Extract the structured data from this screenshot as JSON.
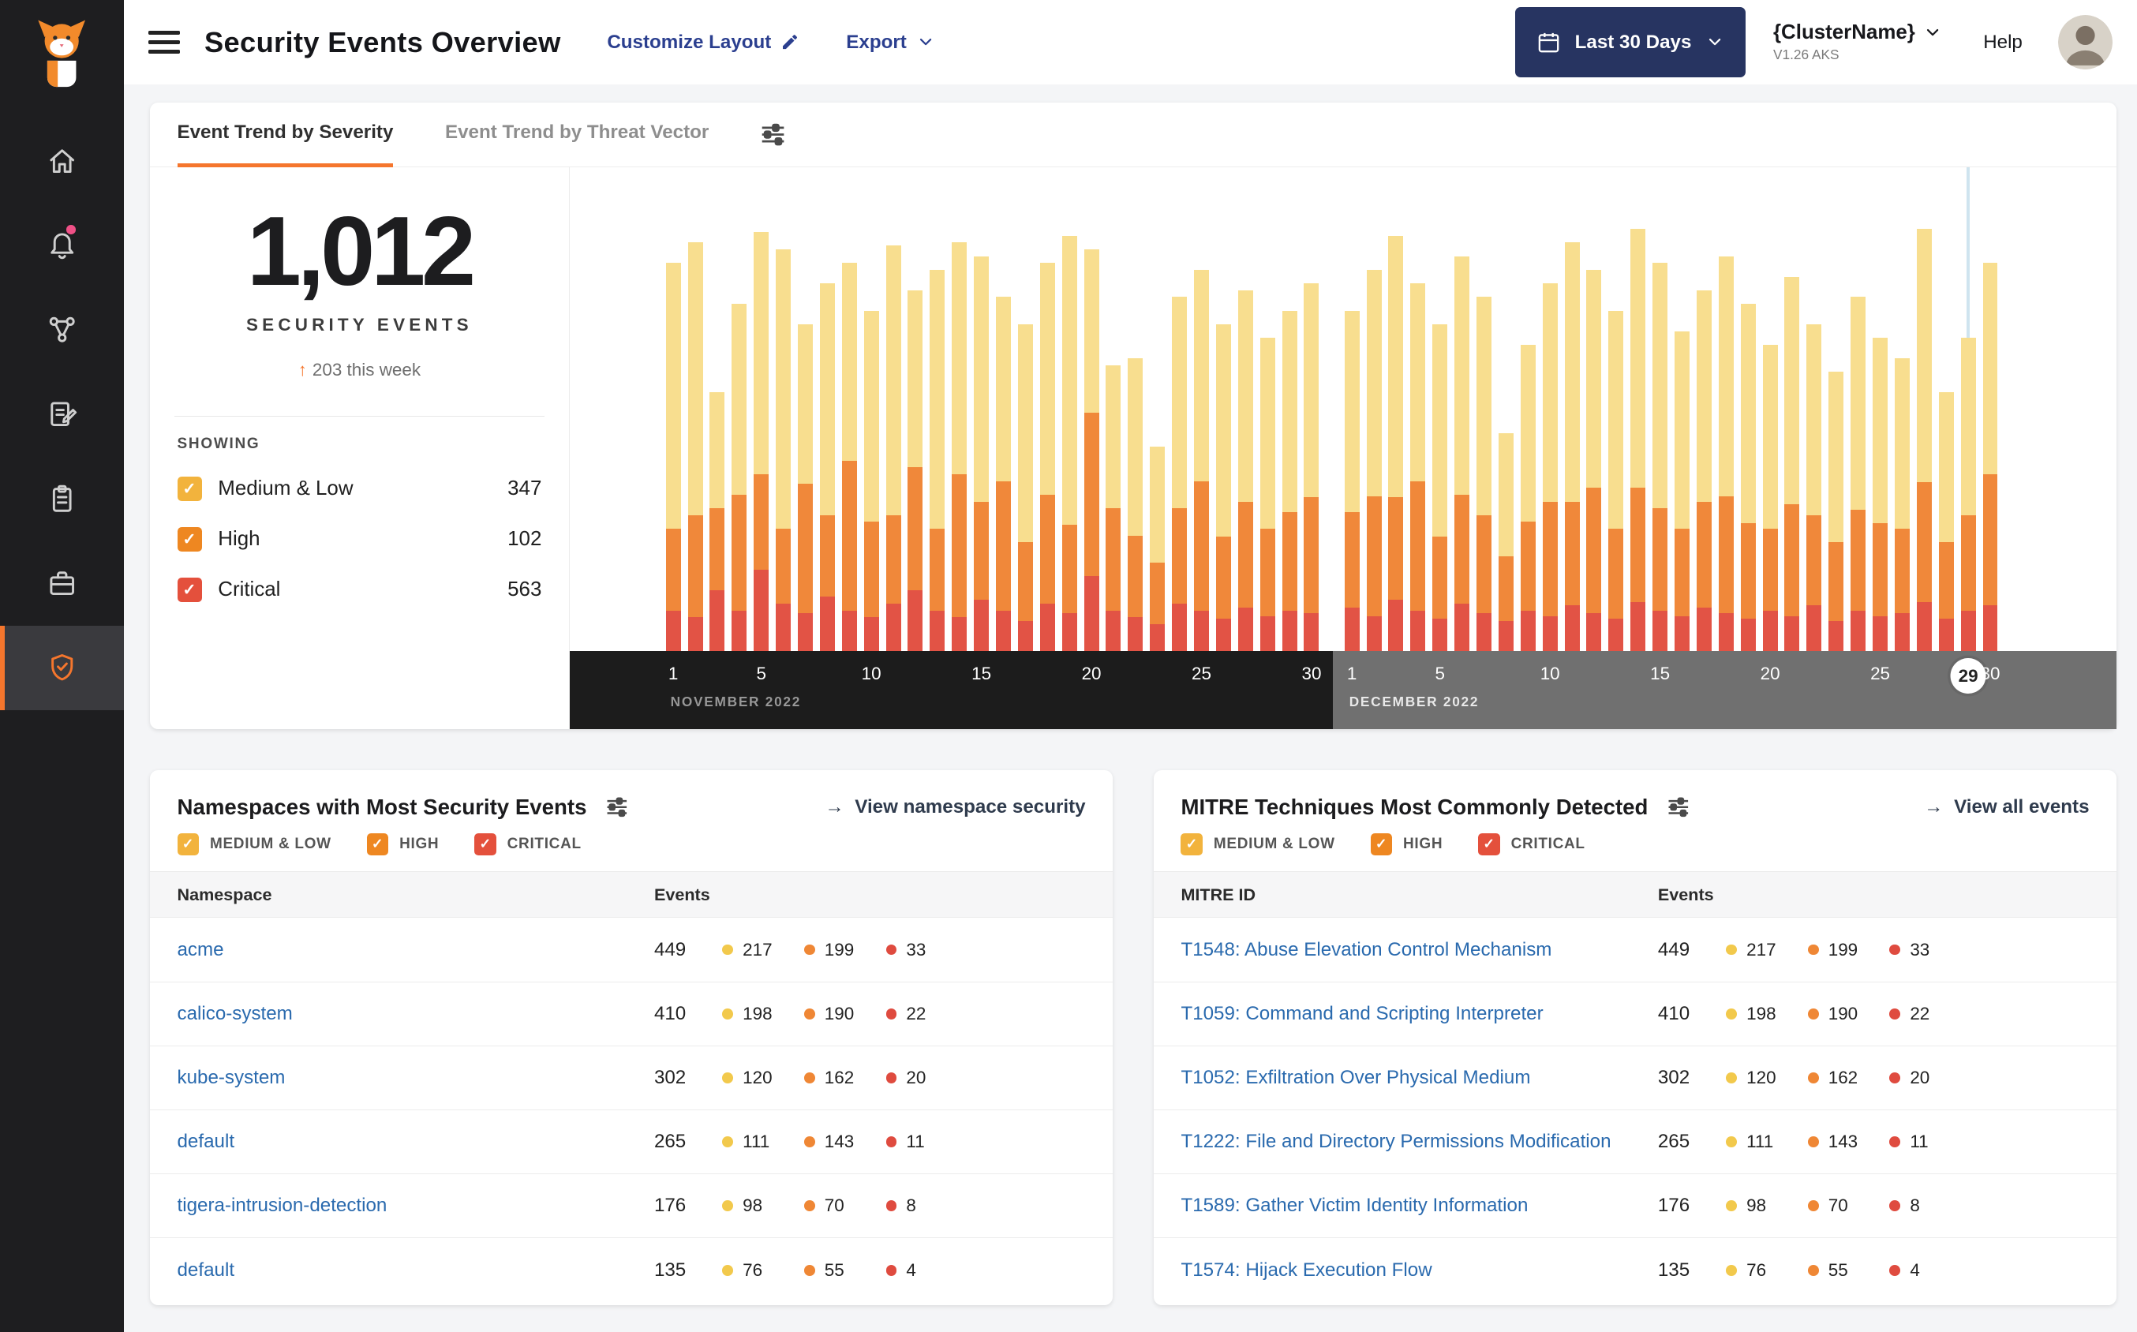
{
  "colors": {
    "medium_low": "#F2B33D",
    "high": "#EE8721",
    "critical": "#E4503C",
    "bar_medium_low": "#F8DE8F",
    "bar_high": "#F0883A",
    "bar_critical": "#E25345",
    "dot_medium_low": "#F2C94C",
    "dot_high": "#EF8735",
    "dot_critical": "#DF4B3F",
    "accent_orange": "#F5762D",
    "link_blue": "#2A6AAE",
    "nav_navy": "#2B3F8F",
    "button_navy": "#273461"
  },
  "sidebar": {
    "items": [
      {
        "icon": "home-icon",
        "active": false
      },
      {
        "icon": "alerts-bell-icon",
        "active": false,
        "notification_dot": true
      },
      {
        "icon": "service-graph-icon",
        "active": false
      },
      {
        "icon": "policies-edit-icon",
        "active": false
      },
      {
        "icon": "compliance-clipboard-icon",
        "active": false
      },
      {
        "icon": "workloads-box-icon",
        "active": false
      },
      {
        "icon": "threat-defense-shield-icon",
        "active": true
      }
    ]
  },
  "header": {
    "title": "Security Events Overview",
    "customize_label": "Customize Layout",
    "export_label": "Export",
    "date_range_label": "Last 30 Days",
    "cluster_name": "{ClusterName}",
    "cluster_version": "V1.26 AKS",
    "help_label": "Help"
  },
  "trend": {
    "tabs": [
      {
        "label": "Event Trend by Severity",
        "active": true
      },
      {
        "label": "Event Trend by Threat Vector",
        "active": false
      }
    ],
    "total": "1,012",
    "total_caption": "SECURITY EVENTS",
    "delta_arrow": "↑",
    "delta_text": "203 this week",
    "showing_label": "SHOWING",
    "legend": [
      {
        "label": "Medium & Low",
        "count": "347",
        "sev": "medium_low"
      },
      {
        "label": "High",
        "count": "102",
        "sev": "high"
      },
      {
        "label": "Critical",
        "count": "563",
        "sev": "critical"
      }
    ]
  },
  "chart_data": {
    "type": "bar",
    "stacked": true,
    "title": "Event Trend by Severity",
    "series_meta": [
      {
        "name": "Medium & Low",
        "color": "#F8DE8F"
      },
      {
        "name": "High",
        "color": "#F0883A"
      },
      {
        "name": "Critical",
        "color": "#E25345"
      }
    ],
    "selected": {
      "month_index": 1,
      "day": 29
    },
    "months": [
      {
        "label": "NOVEMBER 2022",
        "tick_days": [
          1,
          5,
          10,
          15,
          20,
          25,
          30
        ],
        "critical": [
          30,
          25,
          45,
          30,
          60,
          35,
          28,
          40,
          30,
          25,
          35,
          45,
          30,
          25,
          38,
          30,
          22,
          35,
          28,
          55,
          30,
          25,
          20,
          35,
          30,
          24,
          32,
          26,
          30,
          28
        ],
        "high": [
          60,
          75,
          60,
          85,
          70,
          55,
          95,
          60,
          110,
          70,
          65,
          90,
          60,
          105,
          72,
          95,
          58,
          80,
          65,
          120,
          75,
          60,
          45,
          70,
          95,
          60,
          78,
          64,
          72,
          85
        ],
        "medium_low": [
          195,
          200,
          85,
          140,
          178,
          205,
          117,
          170,
          145,
          155,
          198,
          130,
          190,
          170,
          180,
          135,
          160,
          170,
          212,
          120,
          105,
          130,
          85,
          155,
          155,
          156,
          155,
          140,
          148,
          157
        ]
      },
      {
        "label": "DECEMBER 2022",
        "tick_days": [
          1,
          5,
          10,
          15,
          20,
          25,
          30
        ],
        "critical": [
          32,
          26,
          38,
          30,
          24,
          35,
          28,
          22,
          30,
          26,
          34,
          28,
          24,
          36,
          30,
          26,
          32,
          28,
          24,
          30,
          26,
          34,
          22,
          30,
          26,
          28,
          36,
          24,
          30,
          34
        ],
        "high": [
          70,
          88,
          75,
          95,
          60,
          80,
          72,
          48,
          65,
          84,
          76,
          92,
          66,
          84,
          75,
          64,
          78,
          86,
          70,
          60,
          82,
          66,
          58,
          74,
          68,
          62,
          88,
          56,
          70,
          96
        ],
        "medium_low": [
          148,
          166,
          192,
          145,
          156,
          175,
          160,
          90,
          130,
          160,
          190,
          160,
          160,
          190,
          180,
          145,
          155,
          176,
          161,
          135,
          167,
          140,
          125,
          156,
          136,
          125,
          186,
          110,
          130,
          155
        ]
      }
    ]
  },
  "namespaces_card": {
    "title": "Namespaces with Most Security Events",
    "action_arrow": "→",
    "action_label": "View namespace security",
    "filters": [
      {
        "label": "MEDIUM & LOW",
        "sev": "medium_low"
      },
      {
        "label": "HIGH",
        "sev": "high"
      },
      {
        "label": "CRITICAL",
        "sev": "critical"
      }
    ],
    "columns": [
      "Namespace",
      "Events"
    ],
    "rows": [
      {
        "name": "acme",
        "events": "449",
        "medium_low": "217",
        "high": "199",
        "critical": "33"
      },
      {
        "name": "calico-system",
        "events": "410",
        "medium_low": "198",
        "high": "190",
        "critical": "22"
      },
      {
        "name": "kube-system",
        "events": "302",
        "medium_low": "120",
        "high": "162",
        "critical": "20"
      },
      {
        "name": "default",
        "events": "265",
        "medium_low": "111",
        "high": "143",
        "critical": "11"
      },
      {
        "name": "tigera-intrusion-detection",
        "events": "176",
        "medium_low": "98",
        "high": "70",
        "critical": "8"
      },
      {
        "name": "default",
        "events": "135",
        "medium_low": "76",
        "high": "55",
        "critical": "4"
      }
    ]
  },
  "mitre_card": {
    "title": "MITRE Techniques Most Commonly Detected",
    "action_arrow": "→",
    "action_label": "View all events",
    "filters": [
      {
        "label": "MEDIUM & LOW",
        "sev": "medium_low"
      },
      {
        "label": "HIGH",
        "sev": "high"
      },
      {
        "label": "CRITICAL",
        "sev": "critical"
      }
    ],
    "columns": [
      "MITRE ID",
      "Events"
    ],
    "rows": [
      {
        "name": "T1548: Abuse Elevation Control Mechanism",
        "events": "449",
        "medium_low": "217",
        "high": "199",
        "critical": "33"
      },
      {
        "name": "T1059: Command and Scripting Interpreter",
        "events": "410",
        "medium_low": "198",
        "high": "190",
        "critical": "22"
      },
      {
        "name": "T1052: Exfiltration Over Physical Medium",
        "events": "302",
        "medium_low": "120",
        "high": "162",
        "critical": "20"
      },
      {
        "name": "T1222: File and Directory Permissions Modification",
        "events": "265",
        "medium_low": "111",
        "high": "143",
        "critical": "11"
      },
      {
        "name": "T1589: Gather Victim Identity Information",
        "events": "176",
        "medium_low": "98",
        "high": "70",
        "critical": "8"
      },
      {
        "name": "T1574: Hijack Execution Flow",
        "events": "135",
        "medium_low": "76",
        "high": "55",
        "critical": "4"
      }
    ]
  }
}
